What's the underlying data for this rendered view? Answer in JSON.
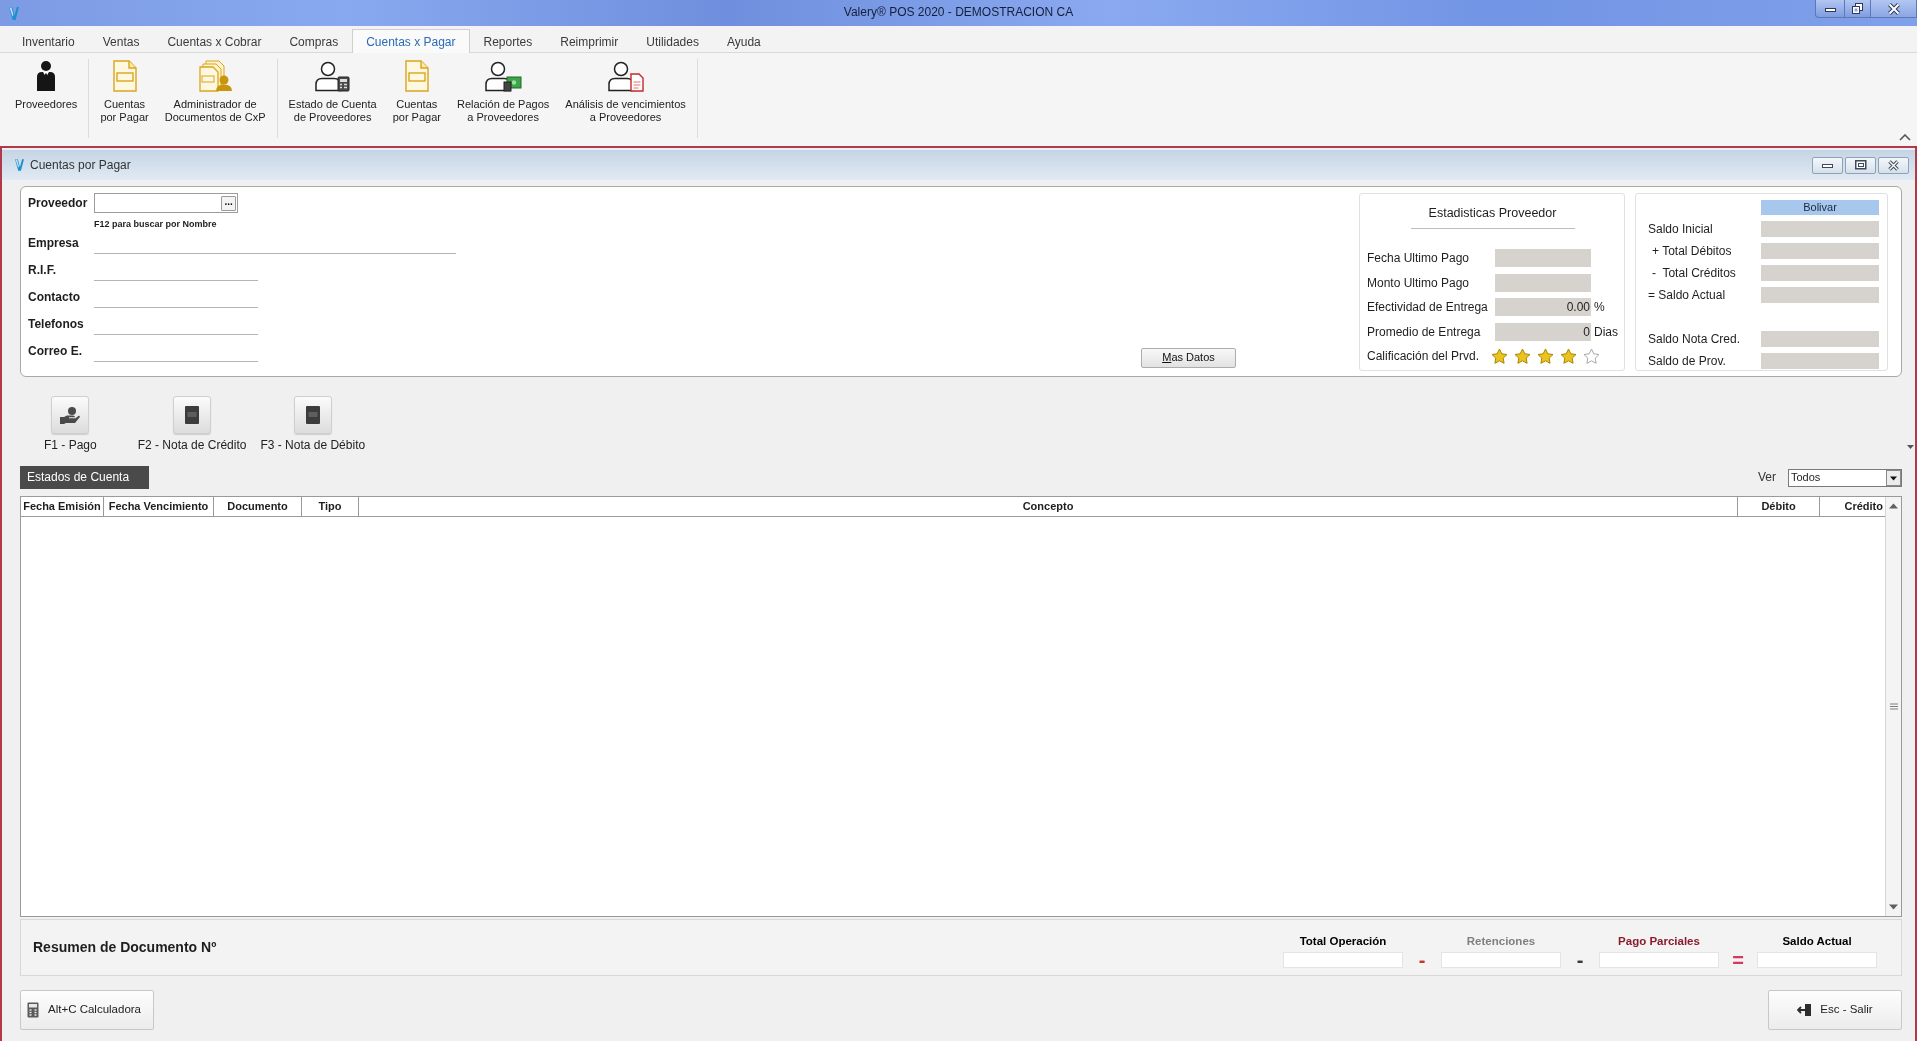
{
  "window": {
    "title": "Valery® POS 2020 - DEMOSTRACION CA"
  },
  "menu_tabs": [
    {
      "label": "Inventario",
      "selected": false
    },
    {
      "label": "Ventas",
      "selected": false
    },
    {
      "label": "Cuentas x Cobrar",
      "selected": false
    },
    {
      "label": "Compras",
      "selected": false
    },
    {
      "label": "Cuentas x Pagar",
      "selected": true
    },
    {
      "label": "Reportes",
      "selected": false
    },
    {
      "label": "Reimprimir",
      "selected": false
    },
    {
      "label": "Utilidades",
      "selected": false
    },
    {
      "label": "Ayuda",
      "selected": false
    }
  ],
  "ribbon": {
    "groups": [
      [
        {
          "lines": [
            "Proveedores"
          ]
        }
      ],
      [
        {
          "lines": [
            "Cuentas",
            "por Pagar"
          ]
        },
        {
          "lines": [
            "Administrador de",
            "Documentos de CxP"
          ]
        }
      ],
      [
        {
          "lines": [
            "Estado de Cuenta",
            "de Proveedores"
          ]
        },
        {
          "lines": [
            "Cuentas",
            "por Pagar"
          ]
        },
        {
          "lines": [
            "Relación de Pagos",
            "a Proveedores"
          ]
        },
        {
          "lines": [
            "Análisis de vencimientos",
            "a Proveedores"
          ]
        }
      ]
    ]
  },
  "child_window": {
    "title": "Cuentas por Pagar"
  },
  "supplier": {
    "label": "Proveedor",
    "lookup_button": "...",
    "hint": "F12 para buscar por Nombre",
    "fields": [
      {
        "label": "Empresa"
      },
      {
        "label": "R.I.F."
      },
      {
        "label": "Contacto"
      },
      {
        "label": "Telefonos"
      },
      {
        "label": "Correo E."
      }
    ],
    "more_button": "Mas Datos"
  },
  "stats": {
    "title": "Estadisticas Proveedor",
    "rows": [
      {
        "label": "Fecha Ultimo Pago"
      },
      {
        "label": "Monto Ultimo Pago"
      },
      {
        "label": "Efectividad de Entrega",
        "value": "0.00",
        "unit": "%"
      },
      {
        "label": "Promedio de Entrega",
        "value": "0",
        "unit": "Dias"
      }
    ],
    "rating": {
      "label": "Calificación del Prvd.",
      "stars": 4
    }
  },
  "balances": {
    "currency": "Bolivar",
    "groups": [
      [
        {
          "label": "Saldo Inicial"
        },
        {
          "label": "+ Total Débitos"
        },
        {
          "label": "-  Total Créditos"
        },
        {
          "label": "= Saldo Actual"
        }
      ],
      [
        {
          "label": "Saldo Nota Cred."
        },
        {
          "label": "Saldo de Prov."
        }
      ]
    ]
  },
  "actions": [
    {
      "label": "F1 - Pago"
    },
    {
      "label": "F2 - Nota de Crédito"
    },
    {
      "label": "F3 - Nota de Débito"
    }
  ],
  "tabs": [
    {
      "label": "Estados de Cuenta",
      "selected": true
    }
  ],
  "filter": {
    "label": "Ver",
    "value": "Todos"
  },
  "table": {
    "columns": [
      "Fecha Emisión",
      "Fecha Vencimiento",
      "Documento",
      "Tipo",
      "Concepto",
      "Débito",
      "Crédito"
    ]
  },
  "summary": {
    "title": "Resumen de Documento Nº",
    "totals": [
      {
        "label": "Total Operación",
        "color": "#000000"
      },
      {
        "label": "Retenciones",
        "color": "#808080"
      },
      {
        "label": "Pago Parciales",
        "color": "#8b1c2c"
      },
      {
        "label": "Saldo Actual",
        "color": "#000000"
      }
    ],
    "operators": [
      {
        "symbol": "-",
        "color": "#c0392b"
      },
      {
        "symbol": "-",
        "color": "#3a3a3a"
      },
      {
        "symbol": "=",
        "color": "#d23c64"
      }
    ]
  },
  "buttons": [
    {
      "label": "Alt+C Calculadora"
    },
    {
      "label": "Esc - Salir"
    }
  ]
}
